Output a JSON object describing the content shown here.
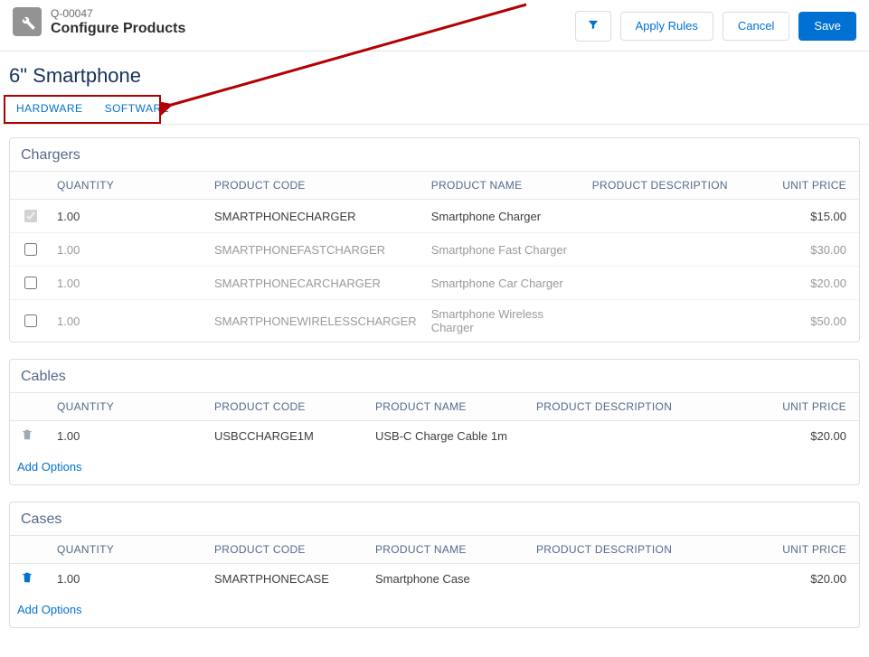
{
  "header": {
    "record_id": "Q-00047",
    "title": "Configure Products",
    "product_title": "6\" Smartphone",
    "buttons": {
      "apply_rules": "Apply Rules",
      "cancel": "Cancel",
      "save": "Save"
    }
  },
  "tabs": [
    {
      "label": "HARDWARE",
      "active": true
    },
    {
      "label": "SOFTWARE",
      "active": false
    }
  ],
  "columns": {
    "quantity": "QUANTITY",
    "code": "PRODUCT CODE",
    "name": "PRODUCT NAME",
    "desc": "PRODUCT DESCRIPTION",
    "price": "UNIT PRICE"
  },
  "sections": [
    {
      "title": "Chargers",
      "add_options": false,
      "rows": [
        {
          "action": "checkbox",
          "checked": true,
          "disabled": true,
          "muted": false,
          "qty": "1.00",
          "code": "SMARTPHONECHARGER",
          "name": "Smartphone Charger",
          "desc": "",
          "price": "$15.00"
        },
        {
          "action": "checkbox",
          "checked": false,
          "disabled": false,
          "muted": true,
          "qty": "1.00",
          "code": "SMARTPHONEFASTCHARGER",
          "name": "Smartphone Fast Charger",
          "desc": "",
          "price": "$30.00"
        },
        {
          "action": "checkbox",
          "checked": false,
          "disabled": false,
          "muted": true,
          "qty": "1.00",
          "code": "SMARTPHONECARCHARGER",
          "name": "Smartphone Car Charger",
          "desc": "",
          "price": "$20.00"
        },
        {
          "action": "checkbox",
          "checked": false,
          "disabled": false,
          "muted": true,
          "qty": "1.00",
          "code": "SMARTPHONEWIRELESSCHARGER",
          "name": "Smartphone Wireless Charger",
          "desc": "",
          "price": "$50.00"
        }
      ]
    },
    {
      "title": "Cables",
      "add_options": true,
      "add_options_label": "Add Options",
      "rows": [
        {
          "action": "trash",
          "trash_active": false,
          "muted": false,
          "qty": "1.00",
          "code": "USBCCHARGE1M",
          "name": "USB-C Charge Cable 1m",
          "desc": "",
          "price": "$20.00"
        }
      ]
    },
    {
      "title": "Cases",
      "add_options": true,
      "add_options_label": "Add Options",
      "rows": [
        {
          "action": "trash",
          "trash_active": true,
          "muted": false,
          "qty": "1.00",
          "code": "SMARTPHONECASE",
          "name": "Smartphone Case",
          "desc": "",
          "price": "$20.00"
        }
      ]
    }
  ]
}
